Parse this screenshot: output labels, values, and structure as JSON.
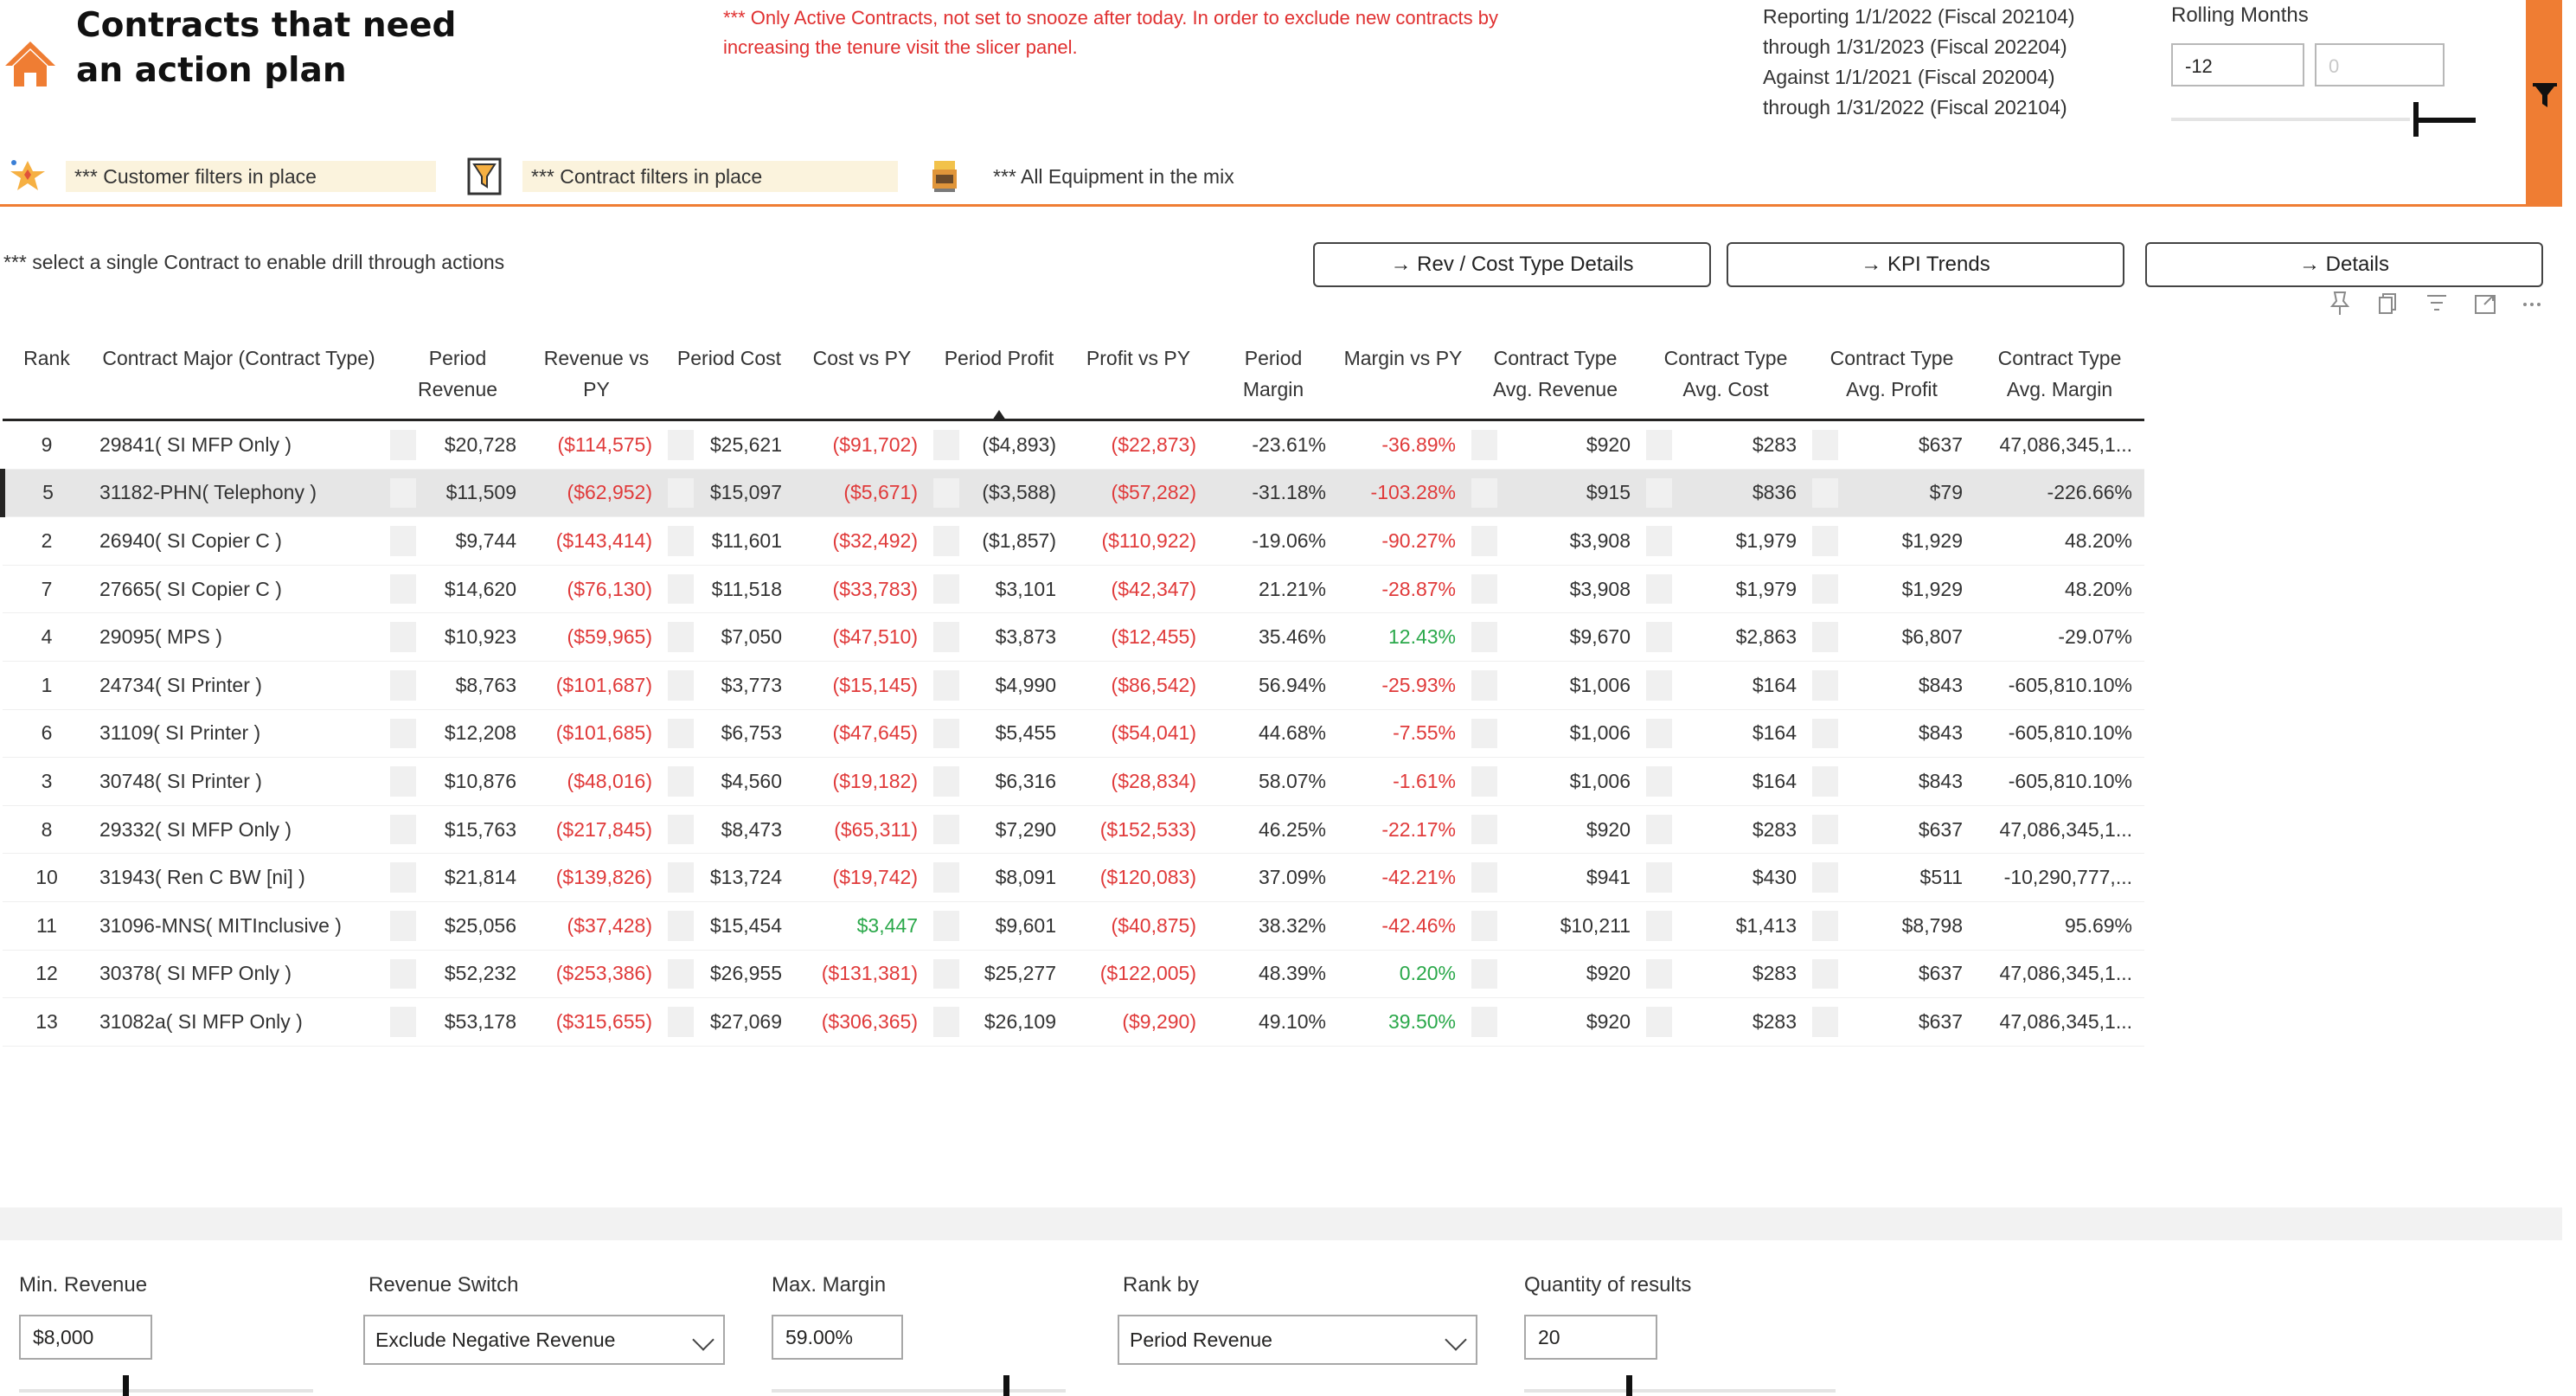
{
  "header": {
    "title": "Contracts that need an action plan",
    "notice": "*** Only Active Contracts, not set to snooze after today. In order to exclude new contracts by increasing the tenure visit the slicer panel.",
    "reporting_lines": [
      "Reporting 1/1/2022 (Fiscal 202104)",
      "through 1/31/2023 (Fiscal 202204)",
      "Against 1/1/2021 (Fiscal 202004)",
      "through 1/31/2022 (Fiscal 202104)"
    ],
    "rolling": {
      "label": "Rolling Months",
      "from": "-12",
      "to": "0"
    }
  },
  "filters": {
    "customer": "*** Customer filters in place",
    "contract": "*** Contract filters in place",
    "equipment": "*** All Equipment in the mix"
  },
  "toolbar": {
    "drill_note": "*** select a single Contract to enable drill through actions",
    "buttons": [
      "→ Rev / Cost Type Details",
      "→ KPI Trends",
      "→ Details"
    ]
  },
  "table": {
    "columns": [
      "Rank",
      "Contract Major (Contract Type)",
      "Period Revenue",
      "Revenue vs PY",
      "Period Cost",
      "Cost vs PY",
      "Period Profit",
      "Profit vs PY",
      "Period Margin",
      "Margin vs PY",
      "Contract Type Avg. Revenue",
      "Contract Type Avg. Cost",
      "Contract Type Avg. Profit",
      "Contract Type Avg. Margin"
    ],
    "rows": [
      [
        "9",
        "29841( SI MFP Only )",
        "$20,728",
        "($114,575)",
        "$25,621",
        "($91,702)",
        "($4,893)",
        "($22,873)",
        "-23.61%",
        "-36.89%",
        "$920",
        "$283",
        "$637",
        "47,086,345,1..."
      ],
      [
        "5",
        "31182-PHN( Telephony )",
        "$11,509",
        "($62,952)",
        "$15,097",
        "($5,671)",
        "($3,588)",
        "($57,282)",
        "-31.18%",
        "-103.28%",
        "$915",
        "$836",
        "$79",
        "-226.66%"
      ],
      [
        "2",
        "26940( SI Copier C )",
        "$9,744",
        "($143,414)",
        "$11,601",
        "($32,492)",
        "($1,857)",
        "($110,922)",
        "-19.06%",
        "-90.27%",
        "$3,908",
        "$1,979",
        "$1,929",
        "48.20%"
      ],
      [
        "7",
        "27665( SI Copier C )",
        "$14,620",
        "($76,130)",
        "$11,518",
        "($33,783)",
        "$3,101",
        "($42,347)",
        "21.21%",
        "-28.87%",
        "$3,908",
        "$1,979",
        "$1,929",
        "48.20%"
      ],
      [
        "4",
        "29095( MPS )",
        "$10,923",
        "($59,965)",
        "$7,050",
        "($47,510)",
        "$3,873",
        "($12,455)",
        "35.46%",
        "12.43%",
        "$9,670",
        "$2,863",
        "$6,807",
        "-29.07%"
      ],
      [
        "1",
        "24734( SI Printer )",
        "$8,763",
        "($101,687)",
        "$3,773",
        "($15,145)",
        "$4,990",
        "($86,542)",
        "56.94%",
        "-25.93%",
        "$1,006",
        "$164",
        "$843",
        "-605,810.10%"
      ],
      [
        "6",
        "31109( SI Printer )",
        "$12,208",
        "($101,685)",
        "$6,753",
        "($47,645)",
        "$5,455",
        "($54,041)",
        "44.68%",
        "-7.55%",
        "$1,006",
        "$164",
        "$843",
        "-605,810.10%"
      ],
      [
        "3",
        "30748( SI Printer )",
        "$10,876",
        "($48,016)",
        "$4,560",
        "($19,182)",
        "$6,316",
        "($28,834)",
        "58.07%",
        "-1.61%",
        "$1,006",
        "$164",
        "$843",
        "-605,810.10%"
      ],
      [
        "8",
        "29332( SI MFP Only )",
        "$15,763",
        "($217,845)",
        "$8,473",
        "($65,311)",
        "$7,290",
        "($152,533)",
        "46.25%",
        "-22.17%",
        "$920",
        "$283",
        "$637",
        "47,086,345,1..."
      ],
      [
        "10",
        "31943( Ren C BW [ni] )",
        "$21,814",
        "($139,826)",
        "$13,724",
        "($19,742)",
        "$8,091",
        "($120,083)",
        "37.09%",
        "-42.21%",
        "$941",
        "$430",
        "$511",
        "-10,290,777,..."
      ],
      [
        "11",
        "31096-MNS( MITInclusive )",
        "$25,056",
        "($37,428)",
        "$15,454",
        "$3,447",
        "$9,601",
        "($40,875)",
        "38.32%",
        "-42.46%",
        "$10,211",
        "$1,413",
        "$8,798",
        "95.69%"
      ],
      [
        "12",
        "30378( SI MFP Only )",
        "$52,232",
        "($253,386)",
        "$26,955",
        "($131,381)",
        "$25,277",
        "($122,005)",
        "48.39%",
        "0.20%",
        "$920",
        "$283",
        "$637",
        "47,086,345,1..."
      ],
      [
        "13",
        "31082a( SI MFP Only )",
        "$53,178",
        "($315,655)",
        "$27,069",
        "($306,365)",
        "$26,109",
        "($9,290)",
        "49.10%",
        "39.50%",
        "$920",
        "$283",
        "$637",
        "47,086,345,1..."
      ]
    ]
  },
  "slicers": {
    "min_revenue": {
      "label": "Min. Revenue",
      "value": "$8,000"
    },
    "revenue_switch": {
      "label": "Revenue Switch",
      "value": "Exclude Negative Revenue"
    },
    "max_margin": {
      "label": "Max. Margin",
      "value": "59.00%"
    },
    "rank_by": {
      "label": "Rank by",
      "value": "Period Revenue"
    },
    "quantity": {
      "label": "Quantity of results",
      "value": "20"
    }
  },
  "colors": {
    "accent": "#ef7d33",
    "negative": "#e03a3a",
    "positive": "#2aa84a"
  }
}
